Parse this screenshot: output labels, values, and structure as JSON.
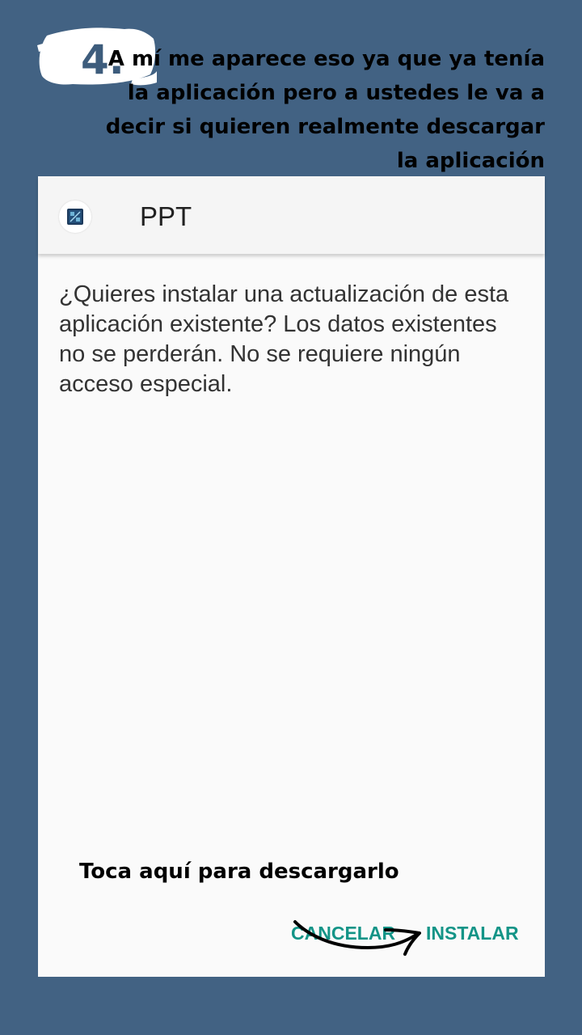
{
  "step": {
    "number": "4.",
    "instruction": "A mí me aparece eso ya que ya tenía la aplicación pero a ustedes le va a decir si quieren realmente descargar la aplicación"
  },
  "dialog": {
    "app_name": "PPT",
    "app_icon": "app-icon",
    "message": "¿Quieres instalar una actualización de esta aplicación existente? Los datos existentes no se perderán. No se requiere ningún acceso especial.",
    "cancel_label": "CANCELAR",
    "install_label": "INSTALAR",
    "accent_color": "#139487"
  },
  "annotation": {
    "hint": "Toca aquí para descargarlo",
    "arrow_icon": "curved-arrow-icon"
  },
  "colors": {
    "background": "#426283",
    "dialog_bg": "#fafafa",
    "appbar_bg": "#f5f5f5"
  }
}
